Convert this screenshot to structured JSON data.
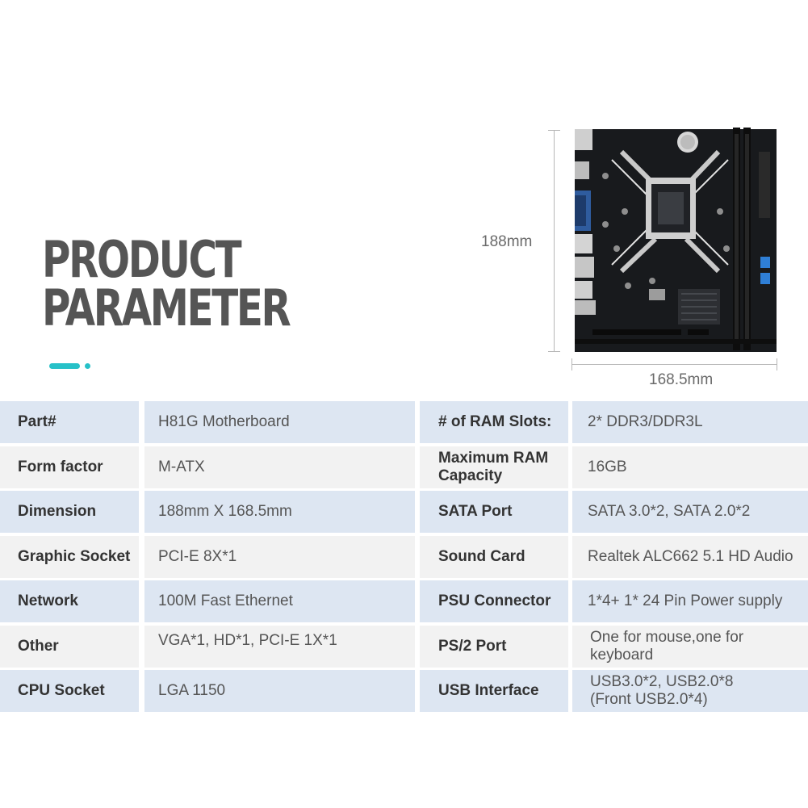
{
  "title": {
    "line1": "PRODUCT",
    "line2": "PARAMETER"
  },
  "dimensions": {
    "height_label": "188mm",
    "width_label": "168.5mm"
  },
  "colors": {
    "accent": "#27c1c8",
    "row_shaded": "#dde6f2",
    "row_plain": "#f2f2f2",
    "title": "#555555"
  },
  "specs": {
    "rows": [
      {
        "label1": "Part#",
        "value1": "H81G Motherboard",
        "label2": "# of RAM Slots:",
        "value2": "2* DDR3/DDR3L"
      },
      {
        "label1": "Form factor",
        "value1": "M-ATX",
        "label2": "Maximum RAM Capacity",
        "value2": "16GB"
      },
      {
        "label1": "Dimension",
        "value1": "188mm X 168.5mm",
        "label2": "SATA Port",
        "value2": "SATA 3.0*2, SATA 2.0*2"
      },
      {
        "label1": "Graphic Socket",
        "value1": "PCI-E 8X*1",
        "label2": "Sound Card",
        "value2": "Realtek ALC662 5.1 HD Audio"
      },
      {
        "label1": "Network",
        "value1": "100M Fast Ethernet",
        "label2": "PSU Connector",
        "value2": "1*4+ 1* 24 Pin Power supply"
      },
      {
        "label1": "Other",
        "value1": "VGA*1, HD*1, PCI-E 1X*1",
        "label2": "PS/2 Port",
        "value2": "One for mouse,one for keyboard"
      },
      {
        "label1": "CPU Socket",
        "value1": "LGA 1150",
        "label2": "USB Interface",
        "value2": "USB3.0*2, USB2.0*8 (Front USB2.0*4)"
      }
    ]
  }
}
